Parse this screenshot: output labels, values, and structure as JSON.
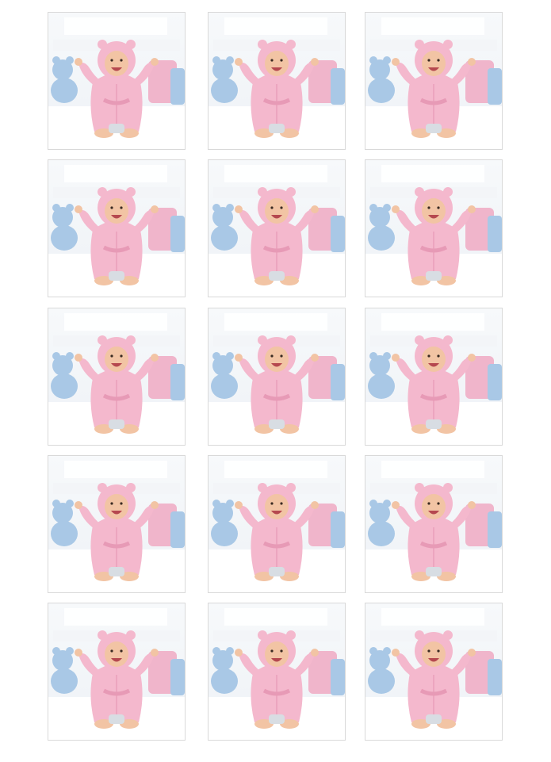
{
  "sheet": {
    "rows": 5,
    "columns": 3,
    "photo_subject": "baby-in-pink-bathrobe",
    "colors": {
      "robe": "#f4b8cd",
      "robe_shadow": "#e79ab6",
      "skin": "#f2c4a4",
      "teddy_blue": "#a9c8e6",
      "pillow_pink": "#f0b5cb",
      "background": "#eef2f6",
      "bed": "#ffffff"
    }
  }
}
